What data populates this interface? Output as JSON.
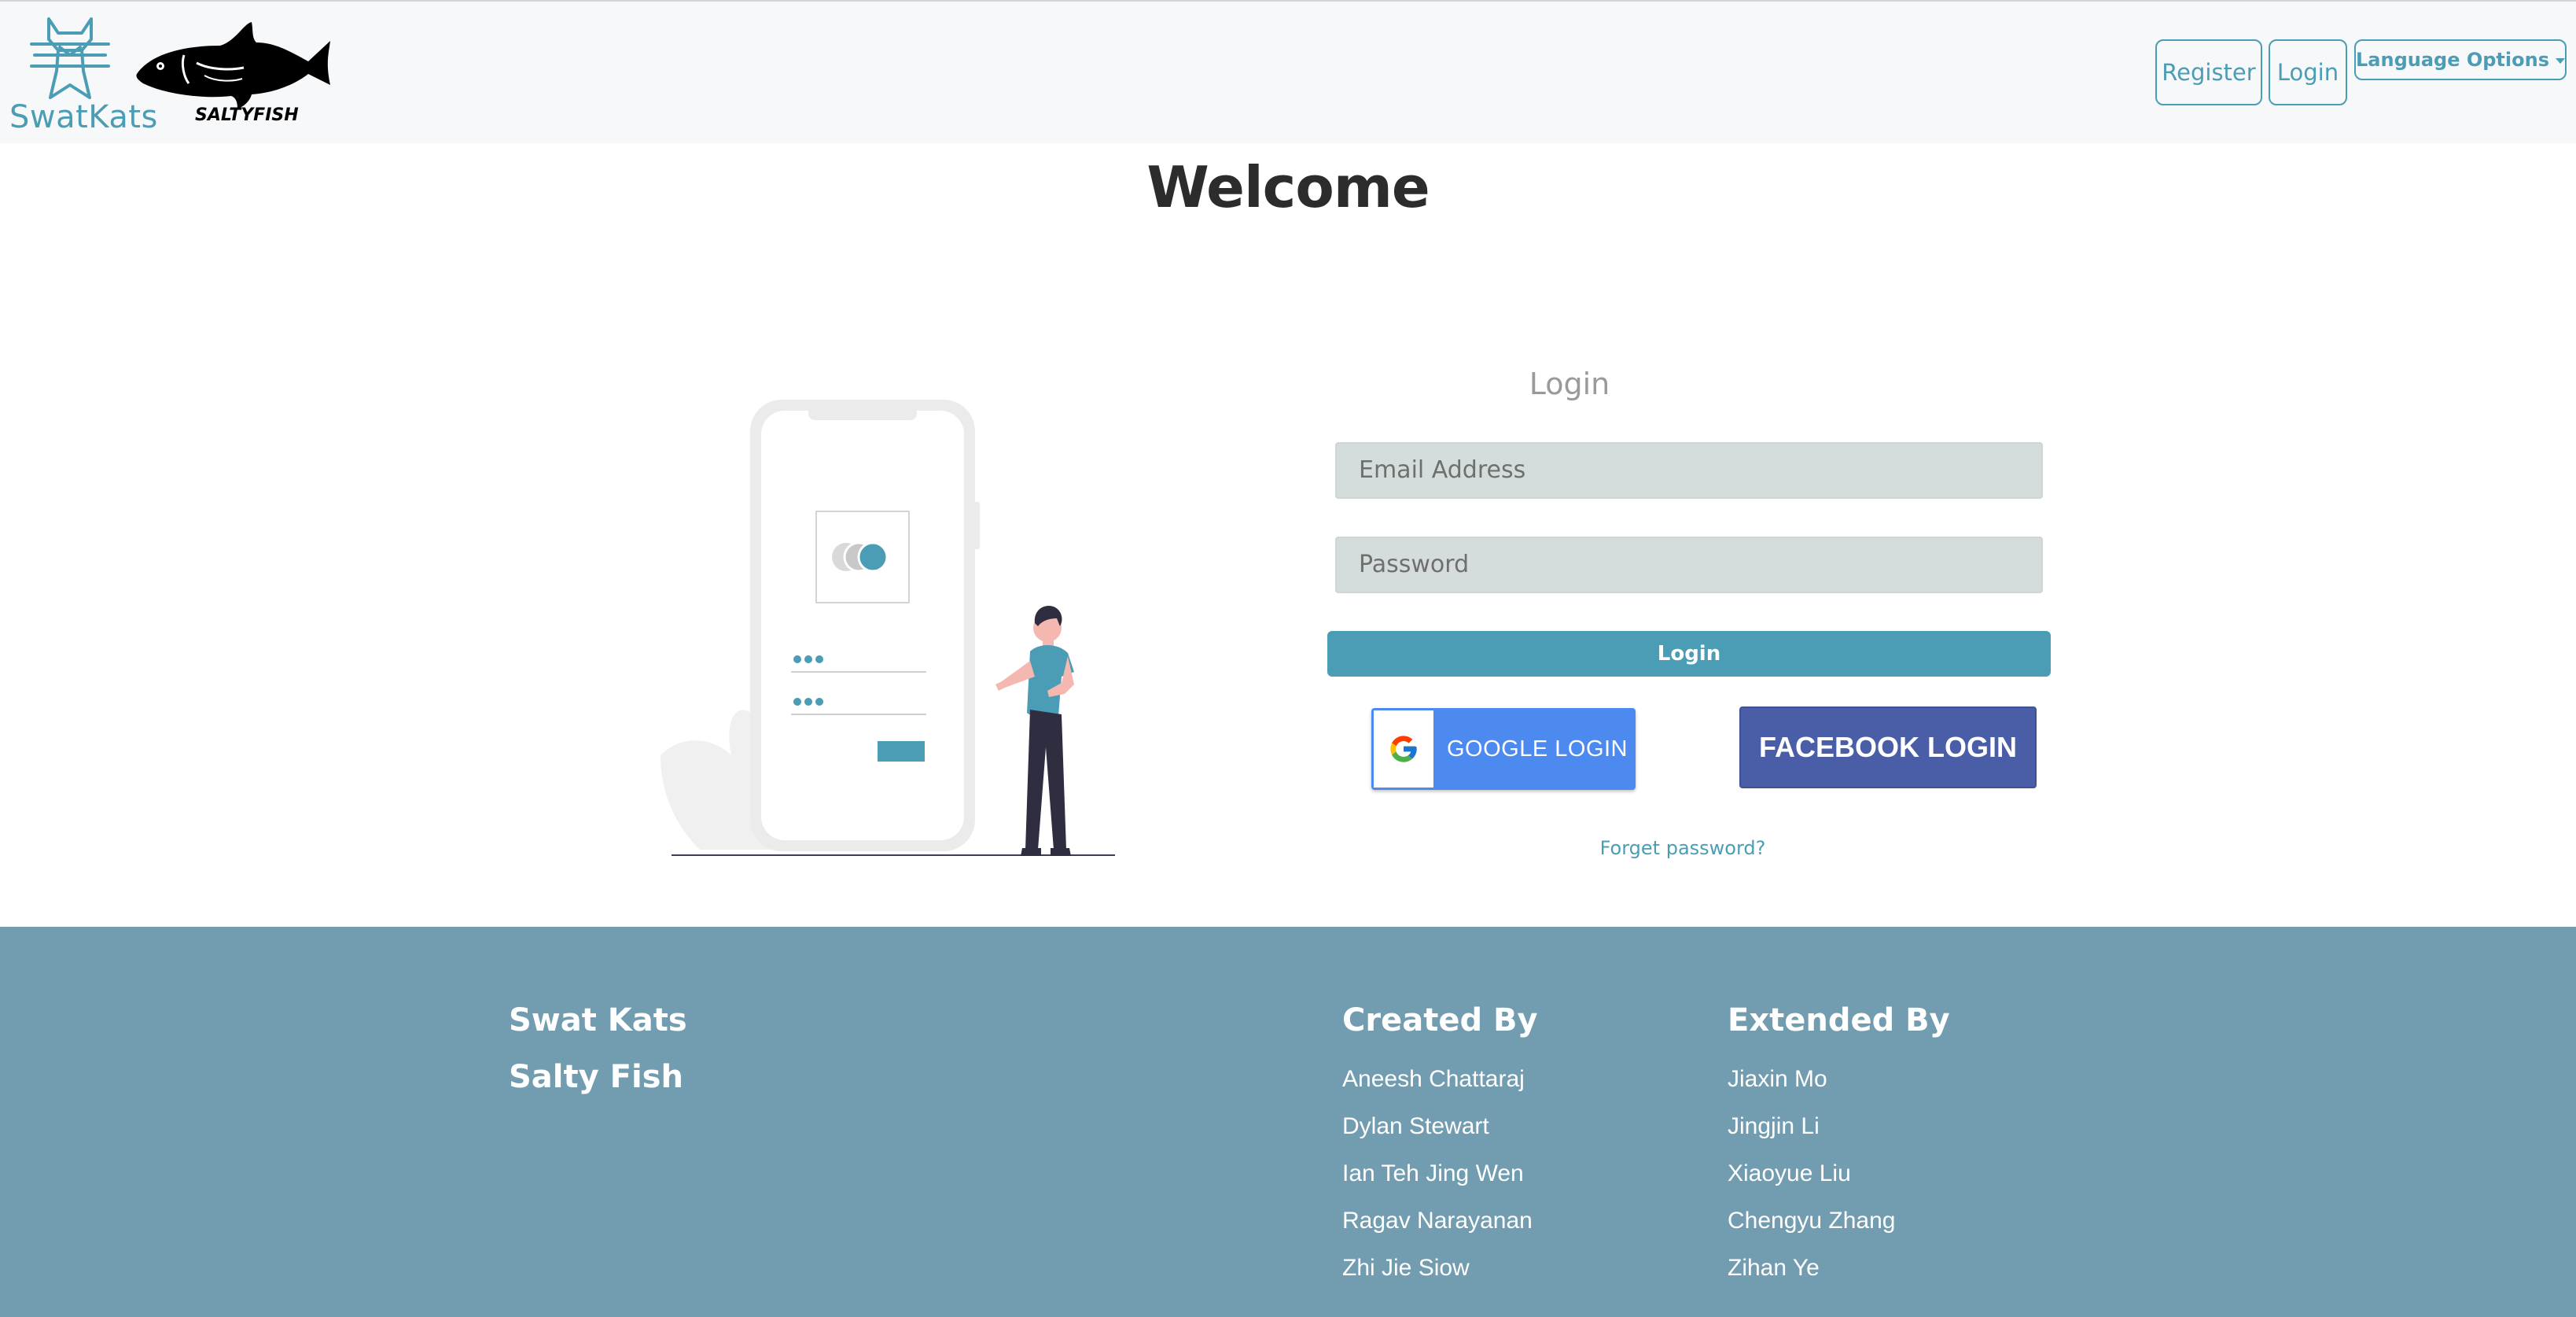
{
  "navbar": {
    "logo_text": "SwatKats",
    "fish_logo_text": "SALTYFISH",
    "register_label": "Register",
    "login_label": "Login",
    "language_label": "Language Options"
  },
  "main": {
    "welcome": "Welcome",
    "login_title": "Login",
    "email_placeholder": "Email Address",
    "password_placeholder": "Password",
    "login_button": "Login",
    "google_button": "GOOGLE LOGIN",
    "facebook_button": "FACEBOOK LOGIN",
    "forget_password": "Forget password?"
  },
  "footer": {
    "brand_lines": [
      "Swat Kats",
      "Salty Fish"
    ],
    "created_by": {
      "title": "Created By",
      "names": [
        "Aneesh Chattaraj",
        "Dylan Stewart",
        "Ian Teh Jing Wen",
        "Ragav Narayanan",
        "Zhi Jie Siow"
      ]
    },
    "extended_by": {
      "title": "Extended By",
      "names": [
        "Jiaxin Mo",
        "Jingjin Li",
        "Xiaoyue Liu",
        "Chengyu Zhang",
        "Zihan Ye"
      ]
    }
  },
  "colors": {
    "accent": "#4a9db4",
    "footer_bg": "#729cb0",
    "facebook": "#4a5ea8",
    "google": "#4d8af0",
    "input_bg": "#d5dcdc"
  },
  "icons": {
    "logo": "swatkats-cat-logo",
    "fish": "saltyfish-fish-logo",
    "google": "google-g-icon",
    "illustration": "phone-login-illustration"
  }
}
